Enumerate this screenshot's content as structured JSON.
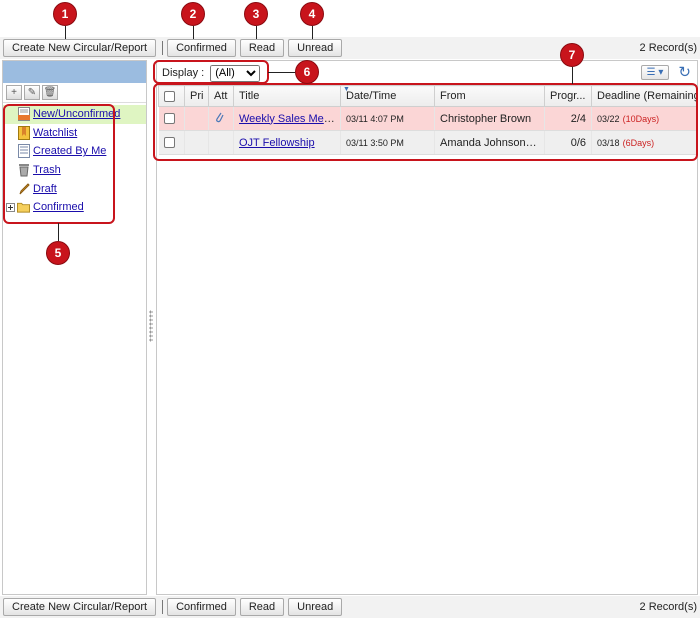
{
  "toolbar": {
    "create_label": "Create New Circular/Report",
    "confirmed_label": "Confirmed",
    "read_label": "Read",
    "unread_label": "Unread",
    "records": "2 Record(s)"
  },
  "sidebar": {
    "items": [
      {
        "label": "New/Unconfirmed",
        "icon": "new-doc-icon"
      },
      {
        "label": "Watchlist",
        "icon": "bookmark-icon"
      },
      {
        "label": "Created By Me",
        "icon": "document-icon"
      },
      {
        "label": "Trash",
        "icon": "trash-icon"
      },
      {
        "label": "Draft",
        "icon": "pencil-icon"
      },
      {
        "label": "Confirmed",
        "icon": "folder-icon"
      }
    ]
  },
  "display": {
    "label": "Display :",
    "selected": "(All)"
  },
  "table": {
    "headers": {
      "pri": "Pri",
      "att": "Att",
      "title": "Title",
      "datetime": "Date/Time",
      "from": "From",
      "progress": "Progr...",
      "deadline": "Deadline (Remaining)"
    },
    "rows": [
      {
        "title": "Weekly Sales Meet...",
        "datetime": "03/11 4:07 PM",
        "from": "Christopher Brown",
        "progress": "2/4",
        "deadline": "03/22",
        "remaining": "(10Days)"
      },
      {
        "title": "OJT Fellowship",
        "datetime": "03/11 3:50 PM",
        "from": "Amanda Johnson [...",
        "progress": "0/6",
        "deadline": "03/18",
        "remaining": "(6Days)"
      }
    ]
  },
  "callouts": [
    "1",
    "2",
    "3",
    "4",
    "5",
    "6",
    "7"
  ],
  "colors": {
    "callout": "#c8141c",
    "sidebar_header": "#9bbce0",
    "selected_node": "#dff5c2",
    "row_highlight": "#fbd6d6",
    "link": "#1a0dab"
  }
}
